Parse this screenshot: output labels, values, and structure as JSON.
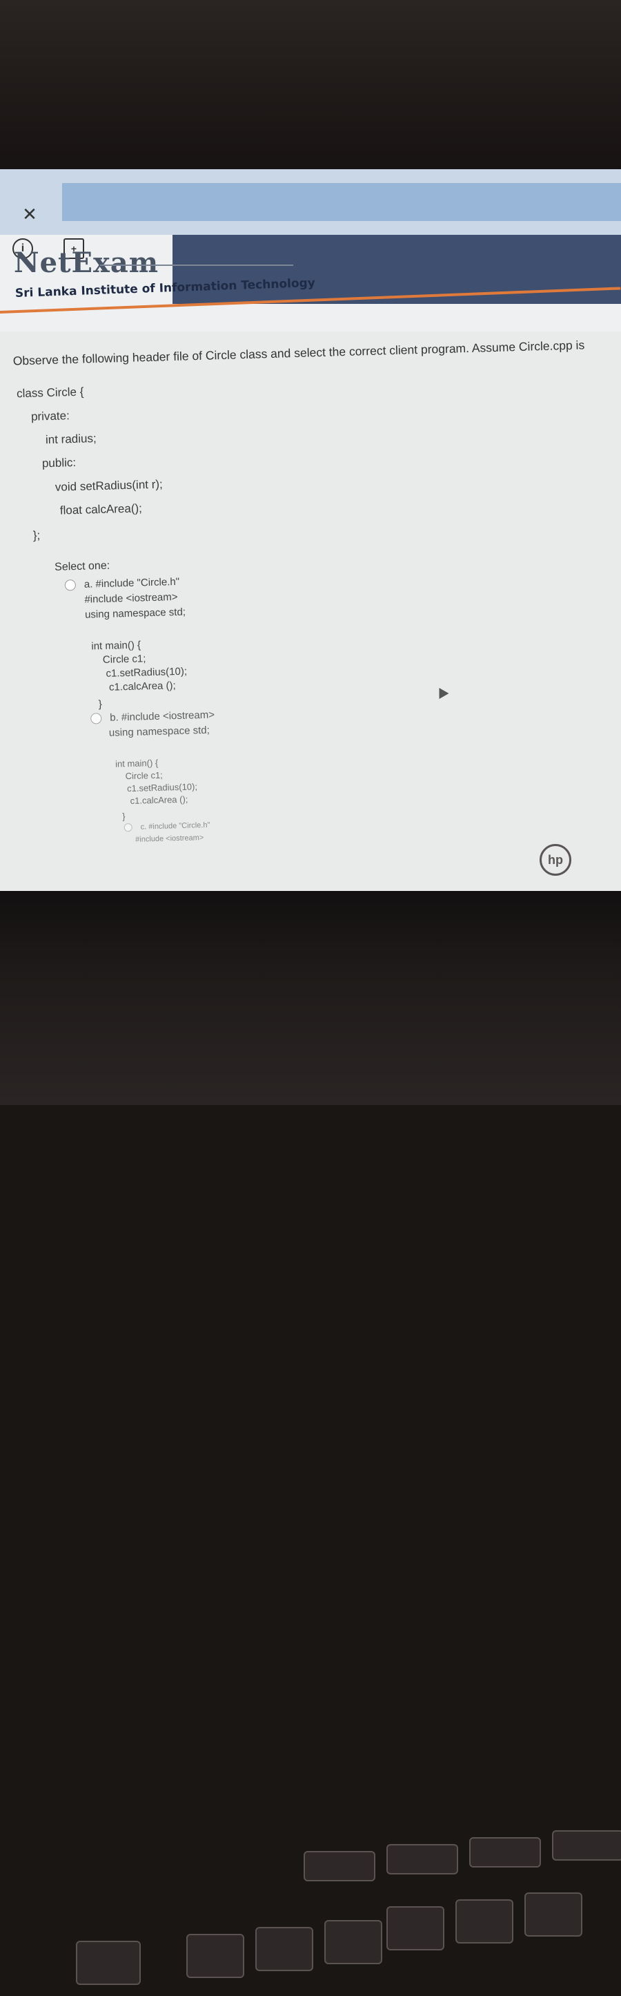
{
  "browser": {
    "close_icon": "close-icon",
    "info_icon": "info-icon",
    "document_icon": "document-icon"
  },
  "header": {
    "logo": "NetExam",
    "institute": "Sri Lanka Institute of Information Technology"
  },
  "question": {
    "prompt": "Observe the following header file of Circle class and select the correct client program. Assume Circle.cpp is",
    "code_lines": [
      "class Circle {",
      "private:",
      "int radius;",
      "public:",
      "void setRadius(int r);",
      "float calcArea();",
      "};"
    ]
  },
  "answer": {
    "select_label": "Select one:",
    "option_a": {
      "label": "a. #include \"Circle.h\"",
      "lines": [
        "#include <iostream>",
        "using namespace std;",
        "int main() {",
        "Circle c1;",
        "c1.setRadius(10);",
        "c1.calcArea ();",
        "}"
      ]
    },
    "option_b": {
      "label": "b. #include <iostream>",
      "lines": [
        "using namespace std;",
        "int main() {",
        "Circle c1;",
        "c1.setRadius(10);",
        "c1.calcArea ();",
        "}"
      ]
    },
    "option_c": {
      "label": "c. #include \"Circle.h\"",
      "lines": [
        "#include <iostream>"
      ]
    }
  },
  "hardware": {
    "brand": "hp"
  }
}
